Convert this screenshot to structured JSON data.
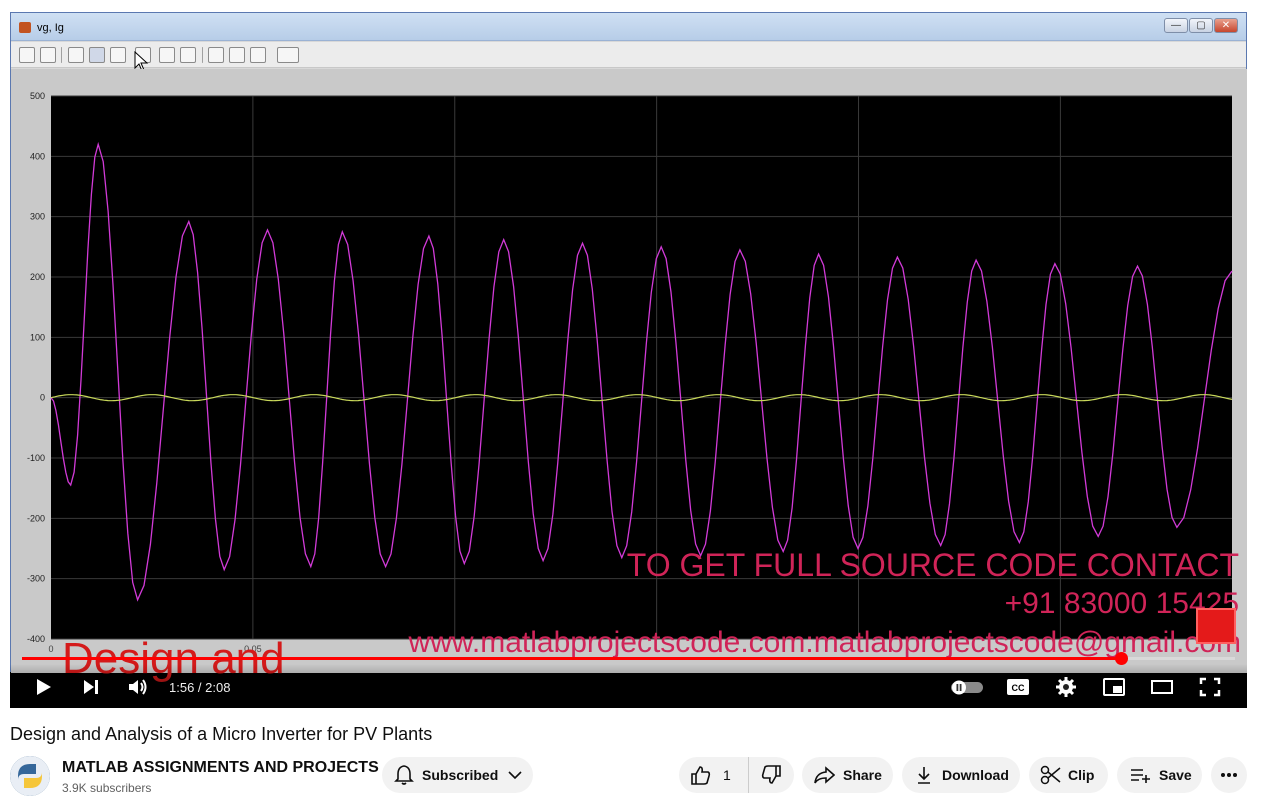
{
  "scope": {
    "window_title": "vg, Ig",
    "window_buttons": [
      "—",
      "▢",
      "✕"
    ],
    "toolbar_icons": [
      "print-icon",
      "params-icon",
      "zoom-in-icon",
      "zoom-x-icon",
      "zoom-y-icon",
      "autoscale-icon",
      "save-axes-icon",
      "restore-axes-icon",
      "floating-scope-icon",
      "lock-icon",
      "signal-selection-icon",
      "legend-icon"
    ]
  },
  "chart_data": {
    "type": "line",
    "title": "",
    "xlabel": "",
    "ylabel": "",
    "ylim": [
      -400,
      500
    ],
    "xlim": [
      0,
      0.3
    ],
    "yticks": [
      "500",
      "400",
      "300",
      "200",
      "100",
      "0",
      "-100",
      "-200",
      "-300",
      "-400"
    ],
    "xticks_visible": [
      "0",
      "0.05"
    ],
    "grid": true,
    "background": "#000000",
    "series": [
      {
        "color": "#d23ad8",
        "kind": "sine",
        "frequency_cycles": 14.6,
        "x": [
          0,
          0.005,
          0.012,
          0.022,
          0.035,
          0.044,
          0.055,
          0.066,
          0.074,
          0.085,
          0.096,
          0.105,
          0.115,
          0.125,
          0.135,
          0.145,
          0.155,
          0.165,
          0.175,
          0.186,
          0.195,
          0.205,
          0.215,
          0.226,
          0.235,
          0.246,
          0.255,
          0.266,
          0.276,
          0.286,
          0.3
        ],
        "y": [
          0,
          -145,
          420,
          -335,
          292,
          -285,
          278,
          -280,
          275,
          -280,
          268,
          -275,
          262,
          -270,
          256,
          -265,
          250,
          -262,
          245,
          -255,
          238,
          -250,
          233,
          -245,
          228,
          -240,
          222,
          -230,
          218,
          -215,
          210
        ]
      },
      {
        "color": "#c8d85a",
        "kind": "sine",
        "x": [
          0,
          0.3
        ],
        "amplitude": 5,
        "y_center": 0
      }
    ]
  },
  "overlay": {
    "promo_line1": "TO GET FULL SOURCE CODE CONTACT",
    "promo_line2": "+91 83000 15425",
    "promo_line3": "www.matlabprojectscode.com:matlabprojectscode@gmail.com",
    "promo_red": "Design and"
  },
  "player": {
    "time": "1:56 / 2:08",
    "progress_fraction": 0.906,
    "controls": [
      "play-icon",
      "next-icon",
      "volume-icon",
      "autoplay-toggle",
      "cc-icon",
      "settings-icon",
      "miniplayer-icon",
      "theater-icon",
      "fullscreen-icon"
    ]
  },
  "video": {
    "title": "Design and Analysis of a Micro Inverter for PV Plants",
    "channel": "MATLAB ASSIGNMENTS AND PROJECTS",
    "subscribers": "3.9K subscribers",
    "subscribed_label": "Subscribed",
    "like_count": "1",
    "share_label": "Share",
    "download_label": "Download",
    "clip_label": "Clip",
    "save_label": "Save"
  }
}
